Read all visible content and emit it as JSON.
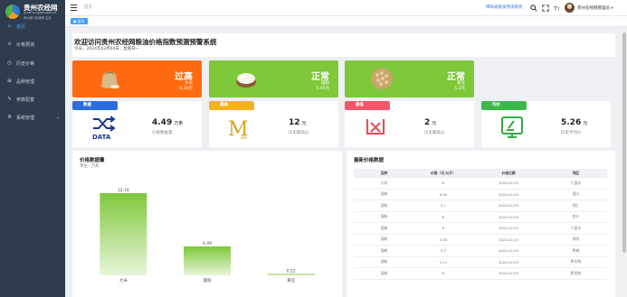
{
  "app": {
    "logo_title": "贵州农经网",
    "logo_sub1": "guizhou.gzdw.gov.cn",
    "logo_sub2": "贵州省人民政府 主办"
  },
  "sidebar": {
    "items": [
      {
        "label": "首页",
        "icon": "home-icon"
      },
      {
        "label": "价格预测",
        "icon": "forecast-icon"
      },
      {
        "label": "历史价格",
        "icon": "history-icon"
      },
      {
        "label": "品种管理",
        "icon": "variety-icon"
      },
      {
        "label": "参数配置",
        "icon": "params-icon"
      },
      {
        "label": "系统管理",
        "icon": "settings-icon"
      }
    ]
  },
  "topbar": {
    "breadcrumb": "首页",
    "system_link": "稀缺省粮食预测系统",
    "user_name": "贵州农经网管理员"
  },
  "tags": {
    "active": "首页"
  },
  "welcome": {
    "title": "欢迎访问贵州农经网粮油价格指数预测预警系统",
    "date": "今天，2024年02月04日，星期日~"
  },
  "status_cards": [
    {
      "status": "过高",
      "name": "大米",
      "price": "6.39元",
      "color": "#ff6a10",
      "icon": "rice-sack-icon"
    },
    {
      "status": "正常",
      "name": "面粉",
      "price": "5.95元",
      "color": "#7ec83a",
      "icon": "flour-bowl-icon"
    },
    {
      "status": "正常",
      "name": "黄豆",
      "price": "5.2元",
      "color": "#7ec83a",
      "icon": "soybean-icon"
    }
  ],
  "stat_cards": [
    {
      "badge": "数据",
      "value": "4.49",
      "unit": "万条",
      "label": "价格数据量",
      "color": "#2d6cdf",
      "icon": "data-shuffle-icon"
    },
    {
      "badge": "最高",
      "value": "12",
      "unit": "元",
      "label": "历史最高价",
      "color": "#f5b21b",
      "icon": "max-icon"
    },
    {
      "badge": "最低",
      "value": "2",
      "unit": "元",
      "label": "历史最低价",
      "color": "#f2566a",
      "icon": "min-icon"
    },
    {
      "badge": "均价",
      "value": "5.26",
      "unit": "元",
      "label": "历史平均价",
      "color": "#3cb84a",
      "icon": "average-icon"
    }
  ],
  "chart_panel": {
    "title": "价格数据量",
    "subtitle": "单位：万条"
  },
  "chart_data": {
    "type": "bar",
    "title": "价格数据量",
    "ylabel": "单位：万条",
    "categories": [
      "大米",
      "面粉",
      "黄豆"
    ],
    "values": [
      12.74,
      4.49,
      0.22
    ],
    "ylim": [
      0,
      14
    ]
  },
  "table_panel": {
    "title": "最新价格数据",
    "columns": [
      "品种",
      "价格（元/公斤）",
      "价格日期",
      "地区"
    ],
    "rows": [
      [
        "大米",
        "6",
        "2024-02-03",
        "六盘水"
      ],
      [
        "面粉",
        "6.65",
        "2024-02-03",
        "遵义"
      ],
      [
        "面粉",
        "5.1",
        "2024-02-03",
        "铜仁"
      ],
      [
        "面粉",
        "8",
        "2024-02-03",
        "金沙"
      ],
      [
        "面粉",
        "6",
        "2024-02-03",
        "六盘水"
      ],
      [
        "面粉",
        "5.65",
        "2024-02-03",
        "贵阳"
      ],
      [
        "面粉",
        "5.3",
        "2024-02-03",
        "黔南"
      ],
      [
        "面粉",
        "5.11",
        "2024-02-03",
        "黔东南"
      ],
      [
        "面粉",
        "6",
        "2024-02-03",
        "黔西南"
      ]
    ]
  }
}
